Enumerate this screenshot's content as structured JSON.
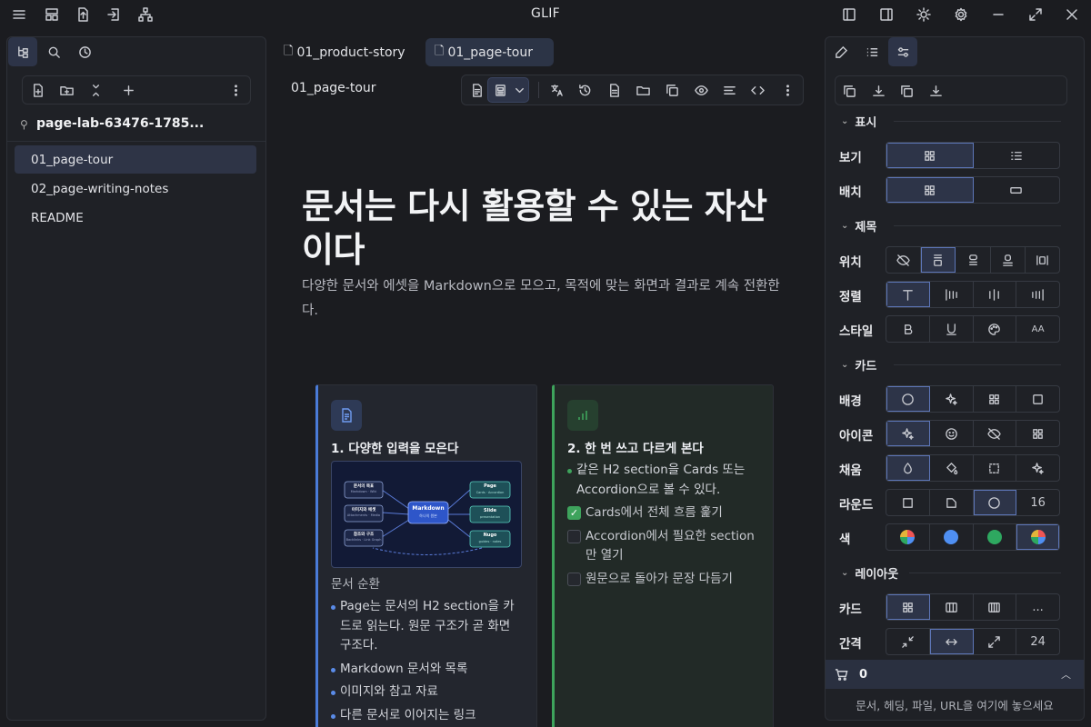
{
  "app": {
    "title": "GLIF"
  },
  "titlebar": {
    "left_icons": [
      "menu-icon",
      "layout-icon",
      "upload-icon",
      "import-icon",
      "sitemap-icon"
    ],
    "right_icons": [
      "left-panel-icon",
      "right-panel-icon",
      "sun-icon",
      "gear-icon",
      "minimize-icon",
      "maximize-icon",
      "close-icon"
    ]
  },
  "left_panel": {
    "tabs": [
      "file-tree-icon",
      "search-icon",
      "clock-icon"
    ],
    "toolbar": [
      "new-file-icon",
      "new-folder-icon",
      "collapse-icon",
      "plus-icon",
      "more-icon"
    ],
    "vault_name": "page-lab-63476-1785...",
    "files": [
      {
        "label": "01_page-tour",
        "active": true
      },
      {
        "label": "02_page-writing-notes",
        "active": false
      },
      {
        "label": "README",
        "active": false
      }
    ]
  },
  "editor": {
    "tabs": [
      {
        "label": "01_product-story",
        "active": false
      },
      {
        "label": "01_page-tour",
        "active": true
      }
    ],
    "breadcrumb": "01_page-tour",
    "toolbar_icons": [
      "doc-icon",
      "page-view-icon",
      "chevron-down-icon",
      "translate-icon",
      "history-icon",
      "file-icon",
      "folder-icon",
      "copy-icon",
      "eye-icon",
      "align-icon",
      "code-icon",
      "more-icon"
    ],
    "heading": "문서는 다시 활용할 수 있는 자산이다",
    "subtitle": "다양한 문서와 에셋을 Markdown으로 모으고, 목적에 맞는 화면과 결과로 계속 전환한다.",
    "cards": [
      {
        "title": "1. 다양한 입력을 모은다",
        "caption": "문서 순환",
        "bullets": [
          "Page는 문서의 H2 section을 카드로 읽는다. 원문 구조가 곧 화면 구조다.",
          "Markdown 문서와 목록",
          "이미지와 참고 자료",
          "다른 문서로 이어지는 링크"
        ],
        "diagram": {
          "inputs": [
            "문서의 목표",
            "이미지와 에셋",
            "참조와 구조"
          ],
          "input_subs": [
            "Markdown · Wiki",
            "Attachments · Media",
            "Backlinks · Link Graph"
          ],
          "center": "Markdown",
          "center_sub": "하나의 원본",
          "outputs": [
            "Page",
            "Slide",
            "Nugo"
          ],
          "output_subs": [
            "Cards · Accordion",
            "presentation",
            "guides · notes"
          ]
        }
      },
      {
        "title": "2. 한 번 쓰고 다르게 본다",
        "bullet": "같은 H2 section을 Cards 또는 Accordion으로 볼 수 있다.",
        "checks": [
          {
            "label": "Cards에서 전체 흐름 훑기",
            "checked": true
          },
          {
            "label": "Accordion에서 필요한 section 만 열기",
            "checked": false
          },
          {
            "label": "원문으로 돌아가 문장 다듬기",
            "checked": false
          }
        ]
      }
    ]
  },
  "right_panel": {
    "tabs": [
      "edit-icon",
      "list-icon",
      "sliders-icon"
    ],
    "toolbar": [
      "copy-icon",
      "download-icon",
      "copy-icon",
      "download-icon"
    ],
    "sections": {
      "display": "표시",
      "title": "제목",
      "card": "카드",
      "layout": "레이아웃"
    },
    "rows": {
      "view": {
        "label": "보기",
        "options": [
          "grid-icon",
          "list-icon"
        ],
        "selected": 0
      },
      "arrange": {
        "label": "배치",
        "options": [
          "grid-icon",
          "rectangle-icon"
        ],
        "selected": 0
      },
      "position": {
        "label": "위치",
        "options": [
          "eye-off-icon",
          "title-top-icon",
          "title-middle-icon",
          "title-bottom-icon",
          "title-side-icon"
        ],
        "selected": 1
      },
      "align": {
        "label": "정렬",
        "options": [
          "text-icon",
          "align-left-icon",
          "align-center-icon",
          "align-right-icon"
        ],
        "selected": 0
      },
      "style": {
        "label": "스타일",
        "options": [
          "bold-icon",
          "underline-icon",
          "palette-icon",
          "font-size-icon"
        ],
        "selected": -1,
        "text_option": "AA"
      },
      "background": {
        "label": "배경",
        "options": [
          "circle-icon",
          "sparkle-icon",
          "grid-icon",
          "square-icon"
        ],
        "selected": 0
      },
      "icon": {
        "label": "아이콘",
        "options": [
          "sparkle-icon",
          "smile-icon",
          "eye-off-icon",
          "grid-icon"
        ],
        "selected": 0
      },
      "fill": {
        "label": "채움",
        "options": [
          "drop-icon",
          "bucket-icon",
          "dotted-square-icon",
          "sparkle-icon"
        ],
        "selected": 0
      },
      "round": {
        "label": "라운드",
        "options": [
          "square-icon",
          "corner-icon",
          "circle-icon"
        ],
        "selected": 2,
        "value": "16"
      },
      "color": {
        "label": "색",
        "options": [
          "multi",
          "#4f8ff2",
          "#2ea860",
          "multi"
        ],
        "selected": 3
      },
      "card": {
        "label": "카드",
        "options": [
          "grid-icon",
          "columns-icon",
          "columns-many-icon"
        ],
        "selected": 0,
        "more": "..."
      },
      "gap": {
        "label": "간격",
        "options": [
          "shrink-icon",
          "horizontal-arrows-icon",
          "expand-icon"
        ],
        "selected": 1,
        "value": "24"
      }
    },
    "cart": {
      "count": "0"
    },
    "dropzone": "문서, 헤딩, 파일, URL을 여기에 놓으세요"
  },
  "colors": {
    "accent": "#4a7bd8",
    "green": "#3ea35c",
    "selected_bg": "#2d3448"
  }
}
